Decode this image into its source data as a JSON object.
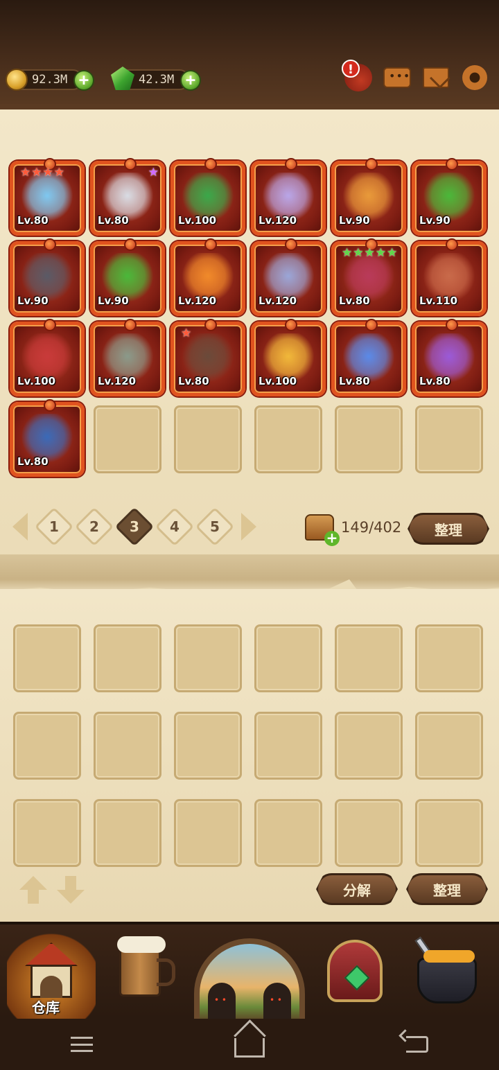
{
  "resources": {
    "gold": "92.3M",
    "gems": "42.3M"
  },
  "top_icons": [
    "alert-icon",
    "chat-icon",
    "mail-icon",
    "gear-icon"
  ],
  "items": [
    {
      "level": "Lv.80",
      "icon": "ice-sword-icon",
      "stars": {
        "count": 4,
        "color": "red"
      }
    },
    {
      "level": "Lv.80",
      "icon": "scimitar-icon",
      "stars": {
        "count": 1,
        "color": "purple"
      }
    },
    {
      "level": "Lv.100",
      "icon": "dragon-icon"
    },
    {
      "level": "Lv.120",
      "icon": "spear-icon"
    },
    {
      "level": "Lv.90",
      "icon": "flame-spear-icon"
    },
    {
      "level": "Lv.90",
      "icon": "green-helmet-icon"
    },
    {
      "level": "Lv.90",
      "icon": "dark-helmet-icon"
    },
    {
      "level": "Lv.90",
      "icon": "green-helmet-icon"
    },
    {
      "level": "Lv.120",
      "icon": "fire-orb-icon"
    },
    {
      "level": "Lv.120",
      "icon": "eyeball-icon"
    },
    {
      "level": "Lv.80",
      "icon": "spellbook-icon",
      "stars": {
        "count": 5,
        "color": "green"
      }
    },
    {
      "level": "Lv.110",
      "icon": "amulet-icon"
    },
    {
      "level": "Lv.100",
      "icon": "ruby-necklace-icon"
    },
    {
      "level": "Lv.120",
      "icon": "armor-icon"
    },
    {
      "level": "Lv.80",
      "icon": "chained-chest-icon",
      "stars": {
        "count": 1,
        "color": "red"
      }
    },
    {
      "level": "Lv.100",
      "icon": "fire-ring-icon"
    },
    {
      "level": "Lv.80",
      "icon": "blue-ring-icon"
    },
    {
      "level": "Lv.80",
      "icon": "amethyst-ring-icon"
    },
    {
      "level": "Lv.80",
      "icon": "boots-icon"
    }
  ],
  "item_empty_slots": 5,
  "pager": {
    "pages": [
      "1",
      "2",
      "3",
      "4",
      "5"
    ],
    "active_page": "3"
  },
  "capacity": "149/402",
  "buttons": {
    "sort_top": "整理",
    "disassemble": "分解",
    "sort_bottom": "整理"
  },
  "bag_empty_slots": 18,
  "nav": {
    "warehouse_label": "仓库",
    "items": [
      "warehouse-icon",
      "tavern-icon",
      "portal-icon",
      "forge-icon",
      "smith-icon"
    ]
  },
  "colors": {
    "item_frame": "#e0531f",
    "item_bg": "#7c1c12",
    "parchment": "#efe2c2",
    "active_page": "#6b4e32"
  }
}
